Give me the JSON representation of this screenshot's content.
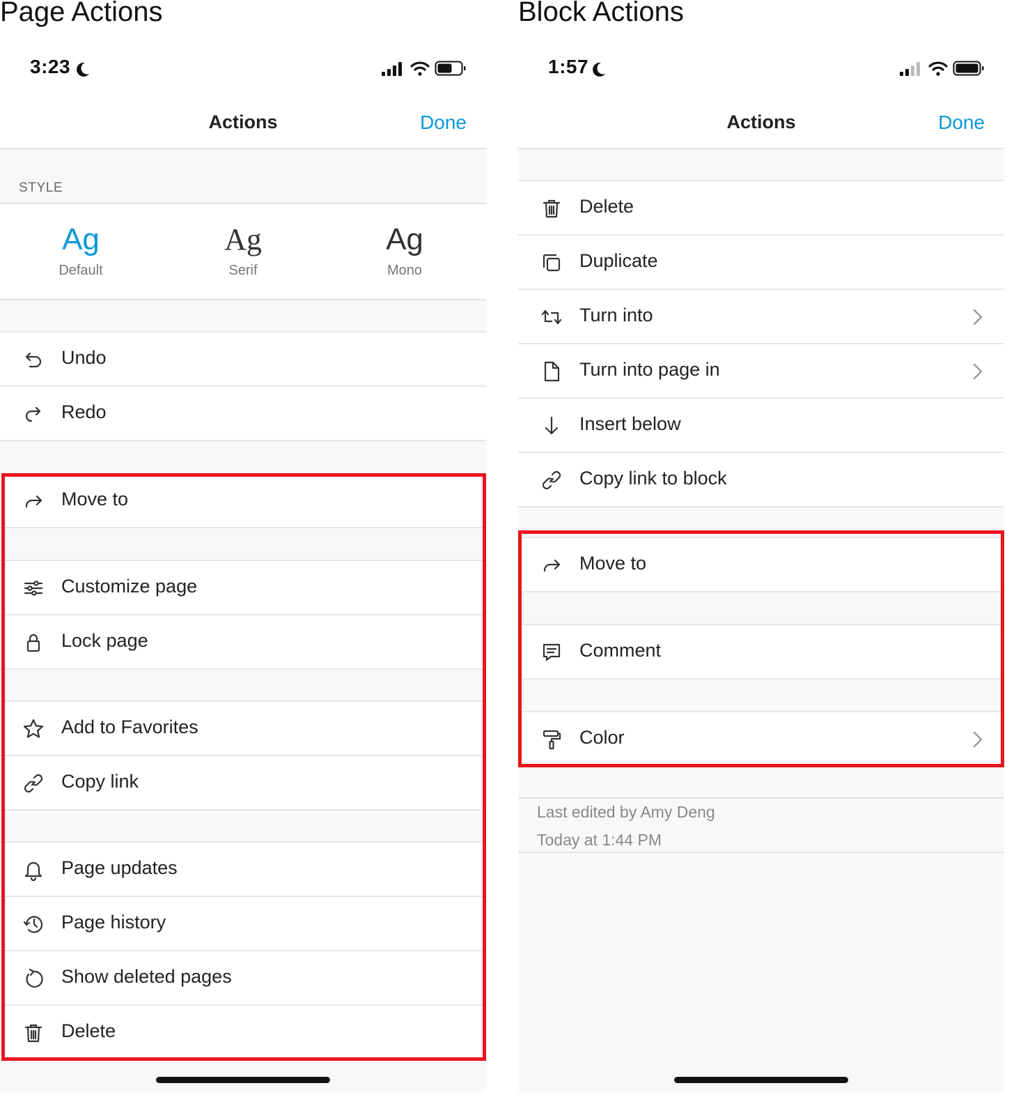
{
  "left": {
    "caption": "Page Actions",
    "status": {
      "time": "3:23"
    },
    "nav": {
      "title": "Actions",
      "done": "Done"
    },
    "style_section": {
      "header": "STYLE",
      "options": [
        {
          "glyph": "Ag",
          "label": "Default"
        },
        {
          "glyph": "Ag",
          "label": "Serif"
        },
        {
          "glyph": "Ag",
          "label": "Mono"
        }
      ]
    },
    "items": {
      "undo": "Undo",
      "redo": "Redo",
      "move_to": "Move to",
      "customize_page": "Customize page",
      "lock_page": "Lock page",
      "add_to_favorites": "Add to Favorites",
      "copy_link": "Copy link",
      "page_updates": "Page updates",
      "page_history": "Page history",
      "show_deleted_pages": "Show deleted pages",
      "delete": "Delete"
    }
  },
  "right": {
    "caption": "Block Actions",
    "status": {
      "time": "1:57"
    },
    "nav": {
      "title": "Actions",
      "done": "Done"
    },
    "items": {
      "delete": "Delete",
      "duplicate": "Duplicate",
      "turn_into": "Turn into",
      "turn_into_page_in": "Turn into page in",
      "insert_below": "Insert below",
      "copy_link_to_block": "Copy link to block",
      "move_to": "Move to",
      "comment": "Comment",
      "color": "Color"
    },
    "footer": {
      "last_edited": "Last edited by Amy Deng",
      "timestamp": "Today at 1:44 PM"
    }
  },
  "colors": {
    "accent": "#0a98d8",
    "highlight_box": "#e8141b",
    "background": "#f8f8f8"
  },
  "icons": [
    "moon-icon",
    "signal-icon",
    "wifi-icon",
    "battery-icon",
    "undo-icon",
    "redo-icon",
    "move-to-icon",
    "sliders-icon",
    "lock-icon",
    "star-icon",
    "link-icon",
    "bell-icon",
    "history-icon",
    "restore-icon",
    "trash-icon",
    "duplicate-icon",
    "turn-into-icon",
    "page-icon",
    "arrow-down-icon",
    "comment-icon",
    "paint-roller-icon",
    "chevron-right-icon"
  ]
}
